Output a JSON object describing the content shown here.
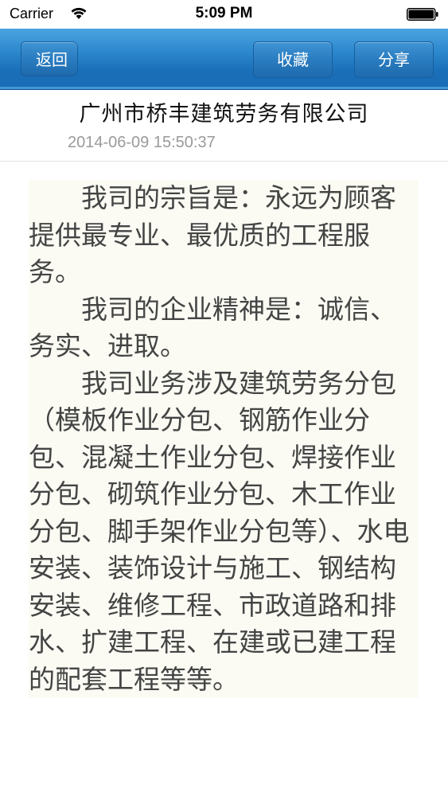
{
  "status_bar": {
    "carrier": "Carrier",
    "time": "5:09 PM"
  },
  "nav": {
    "back_label": "返回",
    "favorite_label": "收藏",
    "share_label": "分享"
  },
  "article": {
    "title": "广州市桥丰建筑劳务有限公司",
    "date": "2014-06-09 15:50:37",
    "paragraphs": [
      "我司的宗旨是：永远为顾客提供最专业、最优质的工程服务。",
      "我司的企业精神是：诚信、务实、进取。",
      "我司业务涉及建筑劳务分包（模板作业分包、钢筋作业分包、混凝土作业分包、焊接作业分包、砌筑作业分包、木工作业分包、脚手架作业分包等）、水电安装、装饰设计与施工、钢结构安装、维修工程、市政道路和排水、扩建工程、在建或已建工程的配套工程等等。"
    ]
  }
}
